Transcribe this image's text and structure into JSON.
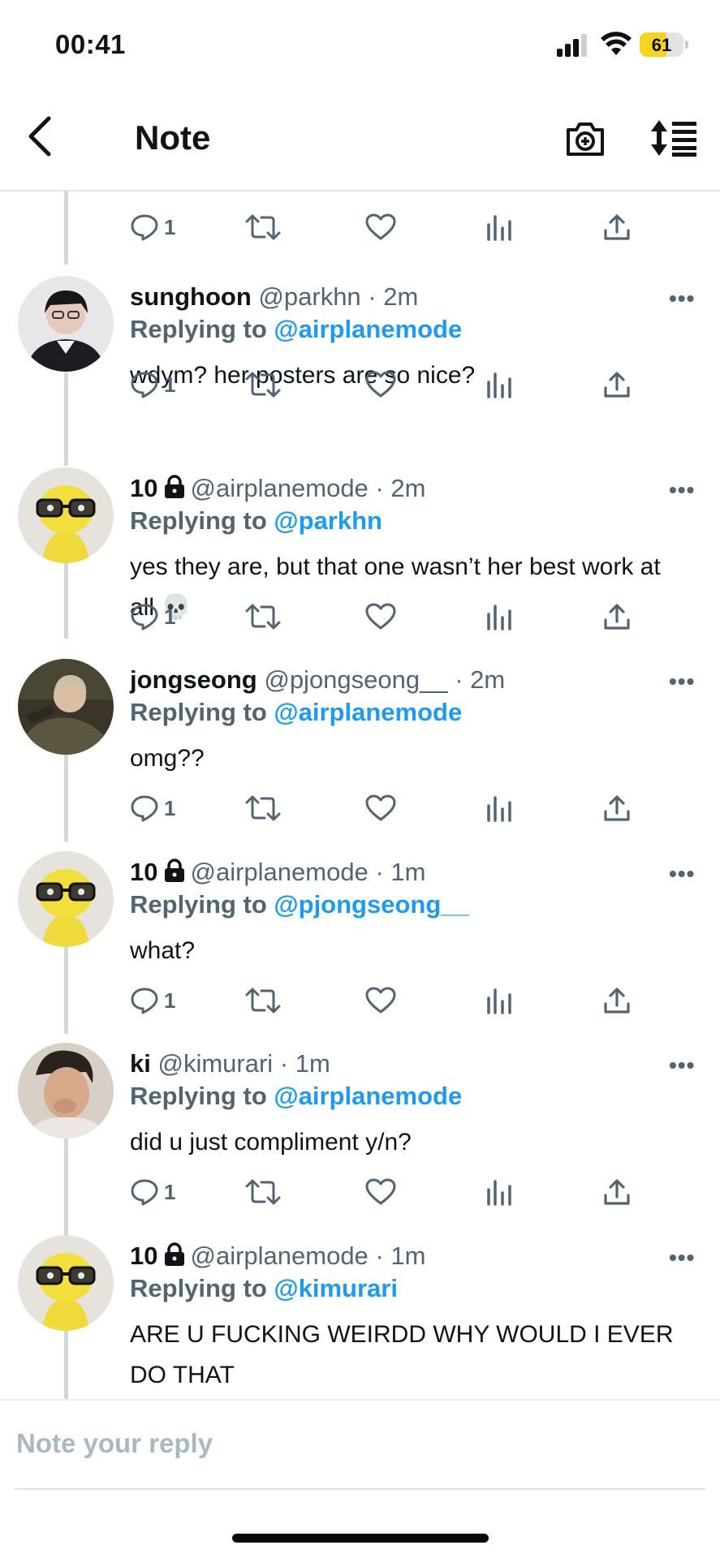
{
  "status_bar": {
    "time": "00:41",
    "battery": "61",
    "battery_level": 0.61,
    "battery_color": "#f6d31f"
  },
  "nav": {
    "title": "Note"
  },
  "colors": {
    "accent": "#1d9bf0",
    "muted": "#536471",
    "line": "#cfd9de"
  },
  "top_actions": {
    "reply_count": "1"
  },
  "tweets": [
    {
      "name": "sunghoon",
      "handle": "@parkhn",
      "time": "· 2m",
      "locked": false,
      "replying_label": "Replying to",
      "replying_to": "@airplanemode",
      "text": "wdym? her posters are so nice?",
      "reply_count": "1",
      "avatar": "person-avatar-dark"
    },
    {
      "name": "10",
      "handle": "@airplanemode",
      "time": "· 2m",
      "locked": true,
      "replying_label": "Replying to",
      "replying_to": "@parkhn",
      "text": "yes they are, but that one wasn’t her best work at all 💀",
      "reply_count": "1",
      "avatar": "yellow-figure-avatar"
    },
    {
      "name": "jongseong",
      "handle": "@pjongseong__",
      "time": "· 2m",
      "locked": false,
      "replying_label": "Replying to",
      "replying_to": "@airplanemode",
      "text": "omg??",
      "reply_count": "1",
      "avatar": "person-avatar-olive"
    },
    {
      "name": "10",
      "handle": "@airplanemode",
      "time": "· 1m",
      "locked": true,
      "replying_label": "Replying to",
      "replying_to": "@pjongseong__",
      "text": "what?",
      "reply_count": "1",
      "avatar": "yellow-figure-avatar"
    },
    {
      "name": "ki",
      "handle": "@kimurari",
      "time": "· 1m",
      "locked": false,
      "replying_label": "Replying to",
      "replying_to": "@airplanemode",
      "text": "did u just compliment y/n?",
      "reply_count": "1",
      "avatar": "person-avatar-warm"
    },
    {
      "name": "10",
      "handle": "@airplanemode",
      "time": "· 1m",
      "locked": true,
      "replying_label": "Replying to",
      "replying_to": "@kimurari",
      "text": "ARE U FUCKING WEIRDD WHY WOULD I EVER DO THAT",
      "reply_count": "",
      "avatar": "yellow-figure-avatar"
    }
  ],
  "compose": {
    "placeholder": "Note your reply"
  }
}
